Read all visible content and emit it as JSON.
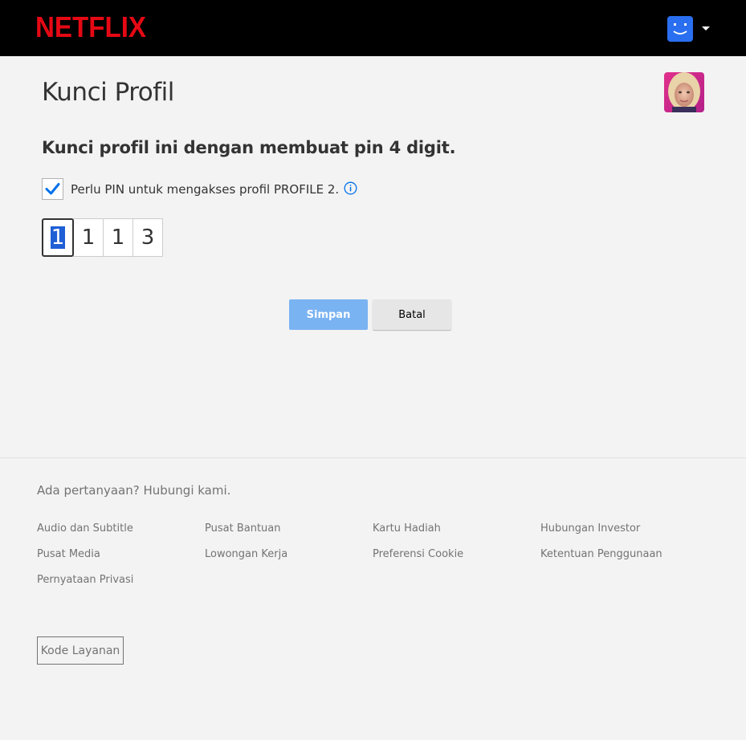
{
  "header": {
    "logo_text": "NETFLIX",
    "brand_color": "#e50914",
    "account_icon": "smiley-profile-icon",
    "account_icon_color": "#2a6ff0"
  },
  "main": {
    "title": "Kunci Profil",
    "profile_avatar": "profile-avatar-image",
    "subtitle": "Kunci profil ini dengan membuat pin 4 digit.",
    "checkbox_checked": true,
    "checkbox_label": "Perlu PIN untuk mengakses profil PROFILE 2.",
    "pin_digits": [
      "1",
      "1",
      "1",
      "3"
    ],
    "save_label": "Simpan",
    "cancel_label": "Batal",
    "save_color": "#7ab3f2"
  },
  "footer": {
    "question": "Ada pertanyaan? Hubungi kami.",
    "links": [
      "Audio dan Subtitle",
      "Pusat Bantuan",
      "Kartu Hadiah",
      "Hubungan Investor",
      "Pusat Media",
      "Lowongan Kerja",
      "Preferensi Cookie",
      "Ketentuan Penggunaan",
      "Pernyataan Privasi"
    ],
    "service_code_label": "Kode Layanan"
  }
}
